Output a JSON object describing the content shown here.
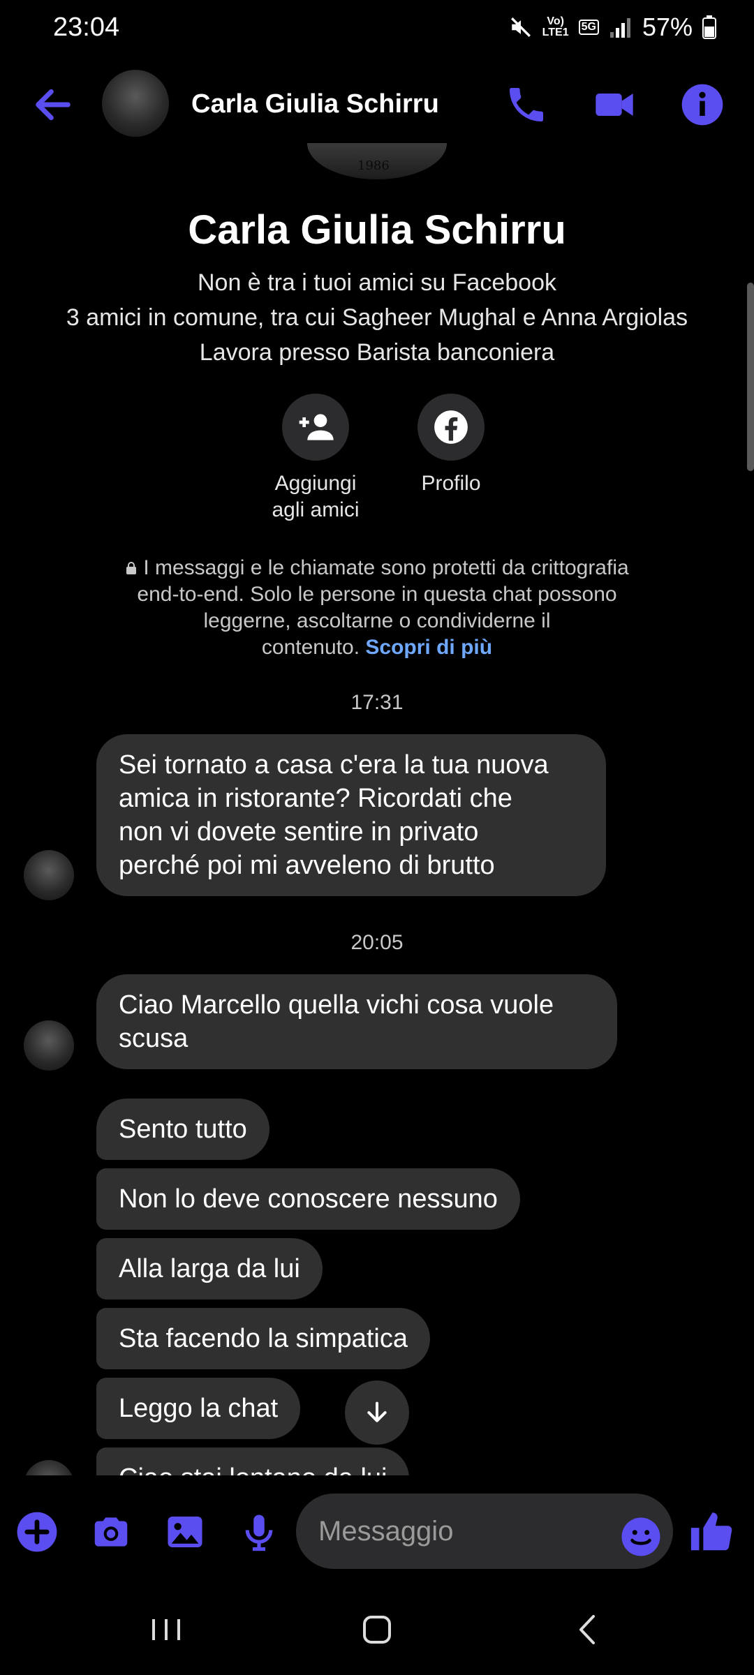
{
  "status_bar": {
    "time": "23:04",
    "net_top": "Vo)",
    "net_bottom": "LTE1",
    "network": "5G",
    "battery": "57%"
  },
  "header": {
    "name": "Carla Giulia Schirru"
  },
  "profile": {
    "cover_text": "1986",
    "name": "Carla Giulia Schirru",
    "friend_status": "Non è tra i tuoi amici su Facebook",
    "mutual_friends": "3 amici in comune, tra cui Sagheer Mughal e Anna Argiolas",
    "work": "Lavora presso Barista banconiera",
    "add_friend_label_1": "Aggiungi",
    "add_friend_label_2": "agli amici",
    "profile_label": "Profilo"
  },
  "encryption": {
    "line1": "I messaggi e le chiamate sono protetti da crittografia",
    "line2": "end-to-end. Solo le persone in questa chat possono",
    "line3": "leggerne, ascoltarne o condividerne il",
    "line4": "contenuto.",
    "link": "Scopri di più"
  },
  "timestamps": [
    "17:31",
    "20:05"
  ],
  "messages": {
    "m1": [
      "Sei tornato a casa c'era la tua nuova",
      "amica in ristorante? Ricordati che",
      "non vi dovete sentire in privato",
      "perché poi mi avveleno di brutto"
    ],
    "m2": [
      "Ciao Marcello quella vichi cosa vuole",
      "scusa"
    ],
    "m3": "Sento tutto",
    "m4": "Non lo deve conoscere nessuno",
    "m5": "Alla larga da lui",
    "m6": "Sta facendo la simpatica",
    "m7": "Leggo la chat",
    "m8": "Ciao stai lontano da lui"
  },
  "composer": {
    "placeholder": "Messaggio"
  },
  "colors": {
    "accent": "#5b4ef0",
    "bubble": "#303030",
    "link": "#6ea8ff"
  }
}
